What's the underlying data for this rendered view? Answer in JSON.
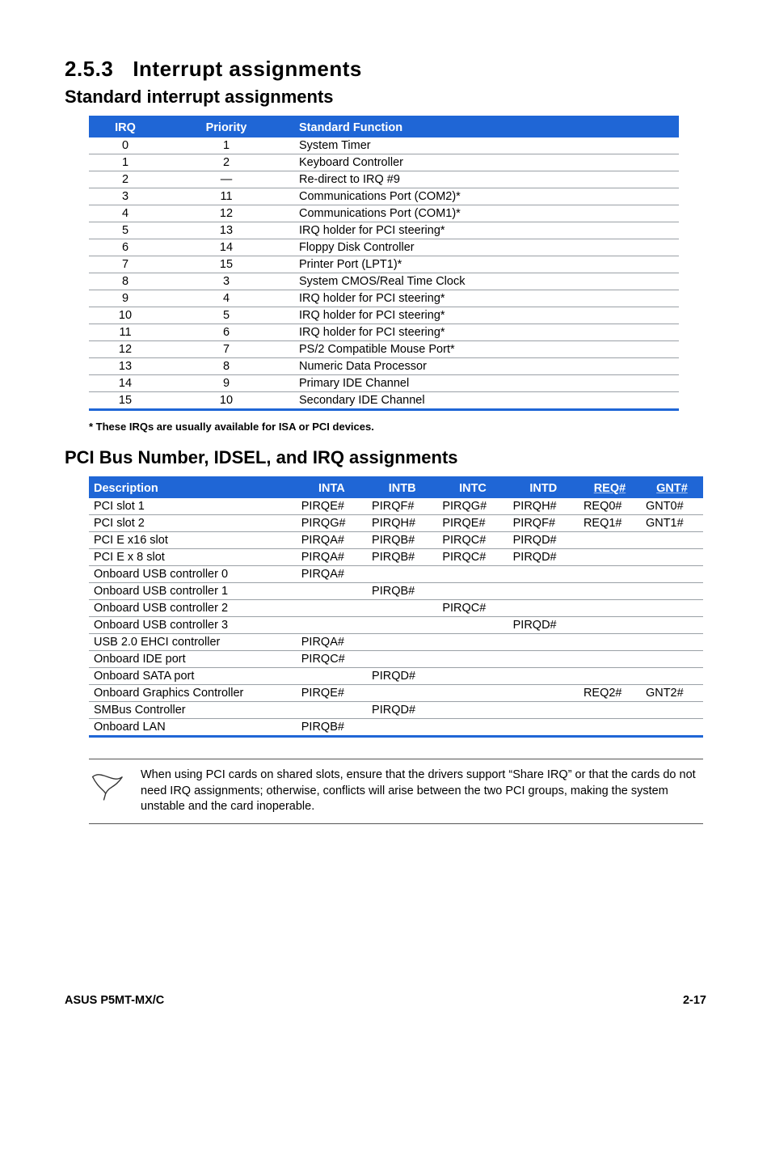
{
  "section": {
    "number": "2.5.3",
    "title": "Interrupt assignments"
  },
  "sub1_title": "Standard interrupt assignments",
  "table1": {
    "headers": {
      "irq": "IRQ",
      "priority": "Priority",
      "func": "Standard Function"
    },
    "rows": [
      {
        "irq": "0",
        "priority": "1",
        "func": "System Timer"
      },
      {
        "irq": "1",
        "priority": "2",
        "func": "Keyboard Controller"
      },
      {
        "irq": "2",
        "priority": "—",
        "func": "Re-direct to IRQ #9"
      },
      {
        "irq": "3",
        "priority": "11",
        "func": "Communications Port (COM2)*"
      },
      {
        "irq": "4",
        "priority": "12",
        "func": "Communications Port (COM1)*"
      },
      {
        "irq": "5",
        "priority": "13",
        "func": "IRQ holder for PCI steering*"
      },
      {
        "irq": "6",
        "priority": "14",
        "func": "Floppy Disk Controller"
      },
      {
        "irq": "7",
        "priority": "15",
        "func": "Printer Port (LPT1)*"
      },
      {
        "irq": "8",
        "priority": "3",
        "func": "System CMOS/Real Time Clock"
      },
      {
        "irq": "9",
        "priority": "4",
        "func": "IRQ holder for PCI steering*"
      },
      {
        "irq": "10",
        "priority": "5",
        "func": "IRQ holder for PCI steering*"
      },
      {
        "irq": "11",
        "priority": "6",
        "func": "IRQ holder for PCI steering*"
      },
      {
        "irq": "12",
        "priority": "7",
        "func": "PS/2 Compatible Mouse Port*"
      },
      {
        "irq": "13",
        "priority": "8",
        "func": "Numeric Data Processor"
      },
      {
        "irq": "14",
        "priority": "9",
        "func": "Primary IDE Channel"
      },
      {
        "irq": "15",
        "priority": "10",
        "func": "Secondary IDE Channel"
      }
    ]
  },
  "footnote": "* These IRQs are usually available for ISA or PCI devices.",
  "sub2_title": "PCI Bus Number, IDSEL, and IRQ assignments",
  "table2": {
    "headers": {
      "desc": "Description",
      "inta": "INTA",
      "intb": "INTB",
      "intc": "INTC",
      "intd": "INTD",
      "req": "REQ#",
      "gnt": "GNT#"
    },
    "rows": [
      {
        "desc": "PCI slot 1",
        "inta": "PIRQE#",
        "intb": "PIRQF#",
        "intc": "PIRQG#",
        "intd": "PIRQH#",
        "req": "REQ0#",
        "gnt": "GNT0#"
      },
      {
        "desc": "PCI slot 2",
        "inta": "PIRQG#",
        "intb": "PIRQH#",
        "intc": "PIRQE#",
        "intd": "PIRQF#",
        "req": "REQ1#",
        "gnt": "GNT1#"
      },
      {
        "desc": "PCI E x16 slot",
        "inta": "PIRQA#",
        "intb": "PIRQB#",
        "intc": "PIRQC#",
        "intd": "PIRQD#",
        "req": "",
        "gnt": ""
      },
      {
        "desc": "PCI E x 8 slot",
        "inta": "PIRQA#",
        "intb": "PIRQB#",
        "intc": "PIRQC#",
        "intd": "PIRQD#",
        "req": "",
        "gnt": ""
      },
      {
        "desc": "Onboard USB controller 0",
        "inta": "PIRQA#",
        "intb": "",
        "intc": "",
        "intd": "",
        "req": "",
        "gnt": ""
      },
      {
        "desc": "Onboard USB controller 1",
        "inta": "",
        "intb": "PIRQB#",
        "intc": "",
        "intd": "",
        "req": "",
        "gnt": ""
      },
      {
        "desc": "Onboard USB controller 2",
        "inta": "",
        "intb": "",
        "intc": "PIRQC#",
        "intd": "",
        "req": "",
        "gnt": ""
      },
      {
        "desc": "Onboard USB controller 3",
        "inta": "",
        "intb": "",
        "intc": "",
        "intd": "PIRQD#",
        "req": "",
        "gnt": ""
      },
      {
        "desc": "USB 2.0 EHCI controller",
        "inta": "PIRQA#",
        "intb": "",
        "intc": "",
        "intd": "",
        "req": "",
        "gnt": ""
      },
      {
        "desc": "Onboard IDE port",
        "inta": "PIRQC#",
        "intb": "",
        "intc": "",
        "intd": "",
        "req": "",
        "gnt": ""
      },
      {
        "desc": "Onboard SATA port",
        "inta": "",
        "intb": "PIRQD#",
        "intc": "",
        "intd": "",
        "req": "",
        "gnt": ""
      },
      {
        "desc": "Onboard Graphics Controller",
        "inta": "PIRQE#",
        "intb": "",
        "intc": "",
        "intd": "",
        "req": "REQ2#",
        "gnt": "GNT2#"
      },
      {
        "desc": "SMBus Controller",
        "inta": "",
        "intb": "PIRQD#",
        "intc": "",
        "intd": "",
        "req": "",
        "gnt": ""
      },
      {
        "desc": "Onboard LAN",
        "inta": "PIRQB#",
        "intb": "",
        "intc": "",
        "intd": "",
        "req": "",
        "gnt": ""
      }
    ]
  },
  "note_text": "When using PCI cards on shared slots, ensure that the drivers support “Share IRQ” or that the cards do not need IRQ assignments; otherwise, conflicts will arise between the two PCI groups, making the system unstable and the card inoperable.",
  "footer": {
    "left": "ASUS P5MT-MX/C",
    "right": "2-17"
  }
}
